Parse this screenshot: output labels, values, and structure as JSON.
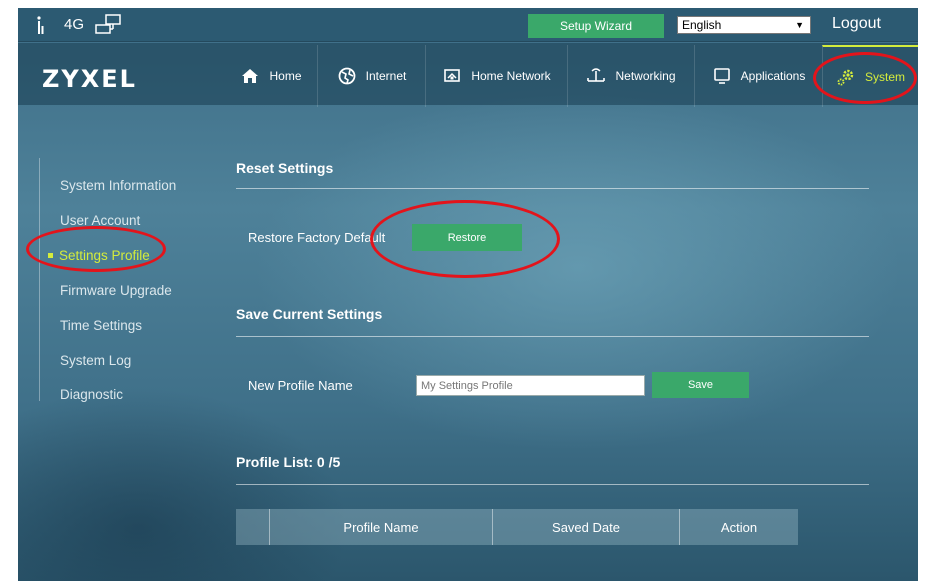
{
  "topbar": {
    "network_type": "4G",
    "setup_wizard_label": "Setup Wizard",
    "language_selected": "English",
    "logout_label": "Logout"
  },
  "brand": {
    "logo_text": "ZYXEL"
  },
  "nav": {
    "items": [
      {
        "label": "Home",
        "icon": "home-icon"
      },
      {
        "label": "Internet",
        "icon": "globe-icon"
      },
      {
        "label": "Home Network",
        "icon": "monitor-icon"
      },
      {
        "label": "Networking",
        "icon": "antenna-icon"
      },
      {
        "label": "Applications",
        "icon": "screen-icon"
      },
      {
        "label": "System",
        "icon": "gear-icon"
      }
    ],
    "active": "System"
  },
  "sidebar": {
    "items": [
      {
        "label": "System Information"
      },
      {
        "label": "User Account"
      },
      {
        "label": "Settings Profile"
      },
      {
        "label": "Firmware Upgrade"
      },
      {
        "label": "Time Settings"
      },
      {
        "label": "System Log"
      },
      {
        "label": "Diagnostic"
      }
    ],
    "active": "Settings Profile"
  },
  "reset": {
    "title": "Reset Settings",
    "label": "Restore Factory Default",
    "button": "Restore"
  },
  "save_current": {
    "title": "Save Current Settings",
    "label": "New Profile Name",
    "input_value": "My Settings Profile",
    "button": "Save"
  },
  "profile_list": {
    "title": "Profile List: 0 /5",
    "columns": [
      "",
      "Profile Name",
      "Saved Date",
      "Action"
    ]
  },
  "colors": {
    "accent_green": "#3aa86a",
    "active_yellow": "#d4ec3c",
    "annotation_red": "#e3141b"
  }
}
